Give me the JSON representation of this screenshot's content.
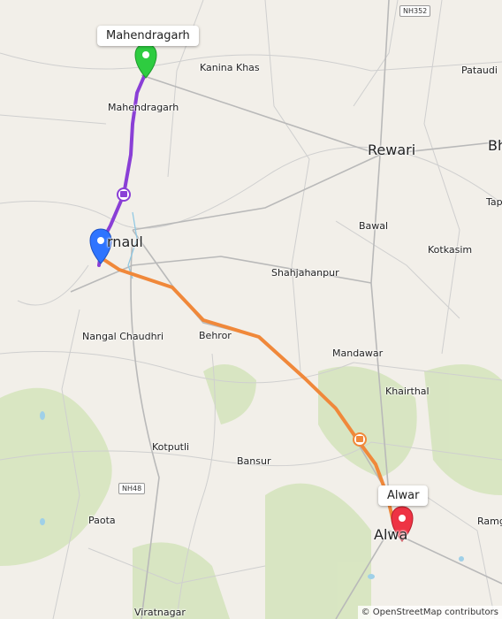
{
  "map": {
    "towns": {
      "mahendragarh": "Mahendragarh",
      "kanina_khas": "Kanina Khas",
      "pataudi": "Pataudi",
      "rewari": "Rewari",
      "bh": "Bh",
      "tap": "Tap",
      "bawal": "Bawal",
      "kotkasim": "Kotkasim",
      "narnaul": "rnaul",
      "shahjahanpur": "Shahjahanpur",
      "nangal_chaudhri": "Nangal Chaudhri",
      "behror": "Behror",
      "mandawar": "Mandawar",
      "khairthal": "Khairthal",
      "kotputli": "Kotputli",
      "bansur": "Bansur",
      "paota": "Paota",
      "alwar": "Alwa",
      "ramg": "Ramg",
      "viratnagar": "Viratnagar"
    },
    "roads": {
      "nh352": "NH352",
      "nh48": "NH48"
    },
    "callouts": {
      "origin": "Mahendragarh",
      "destination": "Alwar"
    },
    "route_colors": {
      "first_leg": "#8a3fd6",
      "second_leg": "#f0883a"
    },
    "marker_colors": {
      "start": "#2ecc40",
      "via": "#2f74ff",
      "end": "#ee3344"
    },
    "attribution": "© OpenStreetMap contributors"
  }
}
